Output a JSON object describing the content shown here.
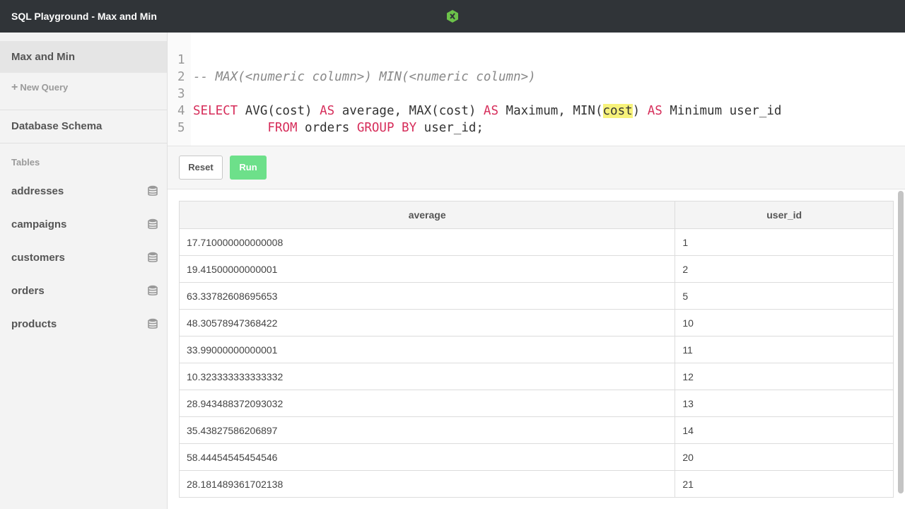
{
  "header": {
    "title": "SQL Playground - Max and Min",
    "logo_icon": "codecademy-logo-icon"
  },
  "sidebar": {
    "active_query": "Max and Min",
    "new_query_label": "New Query",
    "schema_title": "Database Schema",
    "tables_label": "Tables",
    "tables": [
      "addresses",
      "campaigns",
      "customers",
      "orders",
      "products"
    ]
  },
  "editor": {
    "line_numbers": [
      "1",
      "2",
      "3",
      "4",
      "5"
    ],
    "line1_comment": "-- MAX(<numeric column>) MIN(<numeric column>)",
    "line3": {
      "select": "SELECT",
      "t1": " AVG(cost) ",
      "as1": "AS",
      "t2": " average, MAX(cost) ",
      "as2": "AS",
      "t3": " Maximum, MIN(",
      "highlight": "cost",
      "t4": ") ",
      "as3": "AS",
      "t5": " Minimum user_id"
    },
    "line4": {
      "indent": "          ",
      "from": "FROM",
      "t1": " orders ",
      "group": "GROUP",
      "sp": " ",
      "by": "BY",
      "t2": " user_id;"
    }
  },
  "toolbar": {
    "reset_label": "Reset",
    "run_label": "Run"
  },
  "results": {
    "columns": [
      "average",
      "user_id"
    ],
    "rows": [
      [
        "17.710000000000008",
        "1"
      ],
      [
        "19.41500000000001",
        "2"
      ],
      [
        "63.33782608695653",
        "5"
      ],
      [
        "48.30578947368422",
        "10"
      ],
      [
        "33.99000000000001",
        "11"
      ],
      [
        "10.323333333333332",
        "12"
      ],
      [
        "28.943488372093032",
        "13"
      ],
      [
        "35.43827586206897",
        "14"
      ],
      [
        "58.44454545454546",
        "20"
      ],
      [
        "28.181489361702138",
        "21"
      ]
    ]
  },
  "colors": {
    "topbar": "#303438",
    "keyword": "#d62d5a",
    "run_button": "#6de08a",
    "highlight": "#f7f27a"
  }
}
